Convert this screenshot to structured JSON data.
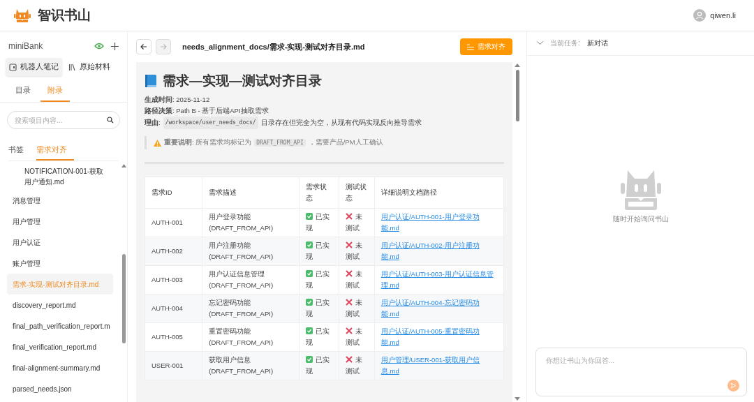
{
  "header": {
    "app_name": "智识书山",
    "user": "qiwen.li"
  },
  "sidebar": {
    "project": "miniBank",
    "views": [
      {
        "label": "机器人笔记",
        "selected": true,
        "kind": "robot"
      },
      {
        "label": "原始材料",
        "selected": false,
        "kind": "books"
      }
    ],
    "tabs": [
      {
        "label": "目录",
        "selected": false
      },
      {
        "label": "附录",
        "selected": true
      }
    ],
    "search": {
      "placeholder": "搜索项目内容..."
    },
    "sub_tabs": [
      {
        "label": "书签",
        "selected": false
      },
      {
        "label": "需求对齐",
        "selected": true
      }
    ],
    "items": [
      {
        "label": "NOTIFICATION-001-获取用户通知.md",
        "kind": "nested",
        "selected": false
      },
      {
        "label": "消息管理",
        "kind": "folder",
        "selected": false
      },
      {
        "label": "用户管理",
        "kind": "folder",
        "selected": false
      },
      {
        "label": "用户认证",
        "kind": "folder",
        "selected": false
      },
      {
        "label": "账户管理",
        "kind": "folder",
        "selected": false
      },
      {
        "label": "需求-实现-测试对齐目录.md",
        "kind": "file",
        "selected": true
      },
      {
        "label": "discovery_report.md",
        "kind": "file",
        "selected": false
      },
      {
        "label": "final_path_verification_report.m",
        "kind": "file",
        "selected": false
      },
      {
        "label": "final_verification_report.md",
        "kind": "file",
        "selected": false
      },
      {
        "label": "final-alignment-summary.md",
        "kind": "file",
        "selected": false
      },
      {
        "label": "parsed_needs.json",
        "kind": "file",
        "selected": false
      }
    ]
  },
  "document": {
    "path": "needs_alignment_docs/需求-实现-测试对齐目录.md",
    "back_disabled": false,
    "forward_disabled": true,
    "action": "需求对齐",
    "title": "需求—实现—测试对齐目录",
    "meta": [
      {
        "parts": [
          {
            "kind": "text",
            "text": "**生成时间**: 2025-11-12"
          }
        ]
      },
      {
        "parts": [
          {
            "kind": "text",
            "text": "**路径决策**: Path B - 基于后端API抽取需求"
          }
        ]
      },
      {
        "parts": [
          {
            "kind": "text",
            "text": "**理由**:"
          },
          {
            "kind": "code",
            "text": "/workspace/user_needs_docs/"
          },
          {
            "kind": "text",
            "text": "目录存在但完全为空，从现有代码实现反向推导需求"
          }
        ]
      }
    ],
    "note": {
      "parts": [
        {
          "kind": "text",
          "text": "**重要说明**: 所有需求均标记为"
        },
        {
          "kind": "code",
          "text": "DRAFT_FROM_API"
        },
        {
          "kind": "text",
          "text": "，需要产品/PM人工确认"
        }
      ]
    },
    "table": {
      "columns": [
        "需求ID",
        "需求描述",
        "需求状态",
        "测试状态",
        "详细说明文档路径"
      ],
      "rows": [
        {
          "id": "AUTH-001",
          "desc": "用户登录功能",
          "tag": "(DRAFT_FROM_API)",
          "implemented": true,
          "impl_text": "已实现",
          "tested": false,
          "test_text": "未测试",
          "link": "用户认证/AUTH-001-用户登录功能.md"
        },
        {
          "id": "AUTH-002",
          "desc": "用户注册功能",
          "tag": "(DRAFT_FROM_API)",
          "implemented": true,
          "impl_text": "已实现",
          "tested": false,
          "test_text": "未测试",
          "link": "用户认证/AUTH-002-用户注册功能.md"
        },
        {
          "id": "AUTH-003",
          "desc": "用户认证信息管理",
          "tag": "(DRAFT_FROM_API)",
          "implemented": true,
          "impl_text": "已实现",
          "tested": false,
          "test_text": "未测试",
          "link": "用户认证/AUTH-003-用户认证信息管理.md"
        },
        {
          "id": "AUTH-004",
          "desc": "忘记密码功能",
          "tag": "(DRAFT_FROM_API)",
          "implemented": true,
          "impl_text": "已实现",
          "tested": false,
          "test_text": "未测试",
          "link": "用户认证/AUTH-004-忘记密码功能.md"
        },
        {
          "id": "AUTH-005",
          "desc": "重置密码功能",
          "tag": "(DRAFT_FROM_API)",
          "implemented": true,
          "impl_text": "已实现",
          "tested": false,
          "test_text": "未测试",
          "link": "用户认证/AUTH-005-重置密码功能.md"
        },
        {
          "id": "USER-001",
          "desc": "获取用户信息",
          "tag": "(DRAFT_FROM_API)",
          "implemented": true,
          "impl_text": "已实现",
          "tested": false,
          "test_text": "未测试",
          "link": "用户管理/USER-001-获取用户信息.md"
        }
      ]
    }
  },
  "chat": {
    "task_label": "当前任务:",
    "task": "新对话",
    "expanded": false,
    "empty_text": "随时开始询问书山",
    "input": {
      "placeholder": "你想让书山为你回答..."
    }
  }
}
